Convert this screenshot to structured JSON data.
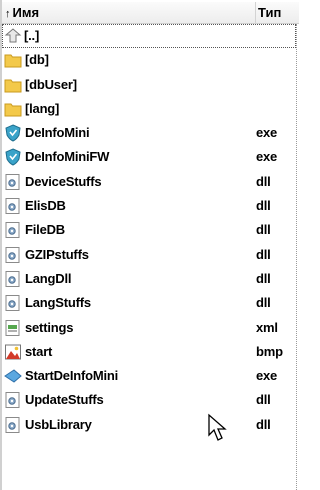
{
  "header": {
    "name_label": "Имя",
    "type_label": "Тип",
    "sort_arrow": "↑"
  },
  "files": [
    {
      "name": "[..]",
      "type": "",
      "icon": "up-icon"
    },
    {
      "name": "[db]",
      "type": "",
      "icon": "folder-icon"
    },
    {
      "name": "[dbUser]",
      "type": "",
      "icon": "folder-icon"
    },
    {
      "name": "[lang]",
      "type": "",
      "icon": "folder-icon"
    },
    {
      "name": "DeInfoMini",
      "type": "exe",
      "icon": "shield-exe-icon"
    },
    {
      "name": "DeInfoMiniFW",
      "type": "exe",
      "icon": "shield-exe-icon"
    },
    {
      "name": "DeviceStuffs",
      "type": "dll",
      "icon": "dll-icon"
    },
    {
      "name": "ElisDB",
      "type": "dll",
      "icon": "dll-icon"
    },
    {
      "name": "FileDB",
      "type": "dll",
      "icon": "dll-icon"
    },
    {
      "name": "GZIPstuffs",
      "type": "dll",
      "icon": "dll-icon"
    },
    {
      "name": "LangDll",
      "type": "dll",
      "icon": "dll-icon"
    },
    {
      "name": "LangStuffs",
      "type": "dll",
      "icon": "dll-icon"
    },
    {
      "name": "settings",
      "type": "xml",
      "icon": "xml-icon"
    },
    {
      "name": "start",
      "type": "bmp",
      "icon": "bmp-icon"
    },
    {
      "name": "StartDeInfoMini",
      "type": "exe",
      "icon": "arrow-exe-icon"
    },
    {
      "name": "UpdateStuffs",
      "type": "dll",
      "icon": "dll-icon"
    },
    {
      "name": "UsbLibrary",
      "type": "dll",
      "icon": "dll-icon"
    }
  ],
  "colors": {
    "folder": "#f3c94a",
    "shield": "#3aa3c9",
    "dll": "#8aa9c8"
  }
}
